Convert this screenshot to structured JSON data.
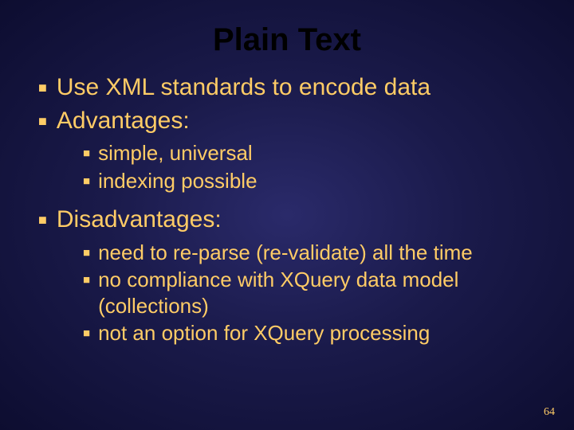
{
  "title": "Plain Text",
  "bullets": [
    {
      "text": "Use XML standards to encode data"
    },
    {
      "text": "Advantages:",
      "children": [
        {
          "text": "simple, universal"
        },
        {
          "text": "indexing possible"
        }
      ]
    },
    {
      "text": "Disadvantages:",
      "children": [
        {
          "text": "need to re-parse (re-validate) all the time"
        },
        {
          "text": "no compliance with XQuery data model (collections)"
        },
        {
          "text": "not an option for XQuery processing"
        }
      ]
    }
  ],
  "page_number": "64"
}
